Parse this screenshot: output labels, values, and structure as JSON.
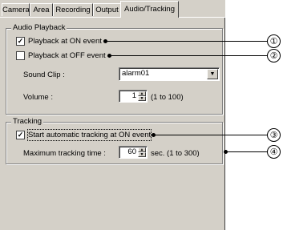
{
  "tabs": [
    {
      "label": "Camera"
    },
    {
      "label": "Area"
    },
    {
      "label": "Recording"
    },
    {
      "label": "Output"
    },
    {
      "label": "Audio/Tracking"
    }
  ],
  "audio_playback": {
    "title": "Audio Playback",
    "on_event": {
      "label": "Playback at ON event",
      "checked": "✓"
    },
    "off_event": {
      "label": "Playback at OFF event",
      "checked": ""
    },
    "sound_clip": {
      "label": "Sound Clip :",
      "value": "alarm01"
    },
    "volume": {
      "label": "Volume :",
      "value": "1",
      "range": "(1 to 100)"
    }
  },
  "tracking": {
    "title": "Tracking",
    "auto_tracking": {
      "label": "Start automatic tracking at ON event",
      "checked": "✓"
    },
    "max_time": {
      "label": "Maximum tracking time :",
      "value": "60",
      "range": "sec. (1 to 300)"
    }
  },
  "callouts": [
    "①",
    "②",
    "③",
    "④"
  ]
}
